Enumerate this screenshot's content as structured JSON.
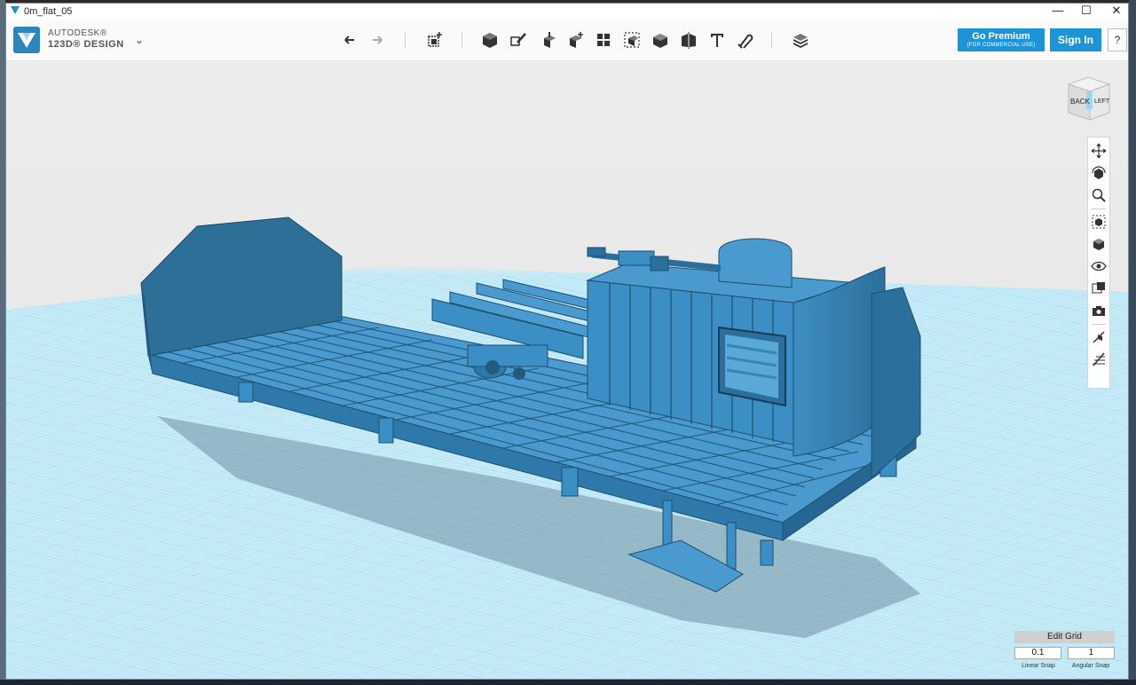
{
  "window": {
    "title": "0m_flat_05",
    "controls": {
      "minimize": "—",
      "maximize": "☐",
      "close": "✕"
    }
  },
  "app": {
    "brand_line1": "AUTODESK®",
    "brand_line2": "123D® DESIGN",
    "menu_chevron": "⌄"
  },
  "toolbar": {
    "undo_icon": "undo-icon",
    "redo_icon": "redo-icon",
    "tools": [
      "transform",
      "primitives",
      "sketch",
      "construct",
      "modify",
      "pattern",
      "grouping",
      "combine",
      "measure",
      "text",
      "snap",
      "materials"
    ]
  },
  "buttons": {
    "premium_label": "Go Premium",
    "premium_sub": "(FOR COMMERCIAL USE)",
    "sign_in": "Sign In",
    "help": "?"
  },
  "viewcube": {
    "face_left": "BACK",
    "face_right": "LEFT"
  },
  "grid": {
    "edit_label": "Edit Grid",
    "linear_snap_value": "0.1",
    "angular_snap_value": "1",
    "linear_snap_label": "Linear Snap",
    "angular_snap_label": "Angular Snap"
  },
  "colors": {
    "model_blue": "#3b8fc4",
    "model_dark": "#2b6f9c",
    "grid_line": "#8fd3ee",
    "brand_blue": "#1b95d6"
  }
}
